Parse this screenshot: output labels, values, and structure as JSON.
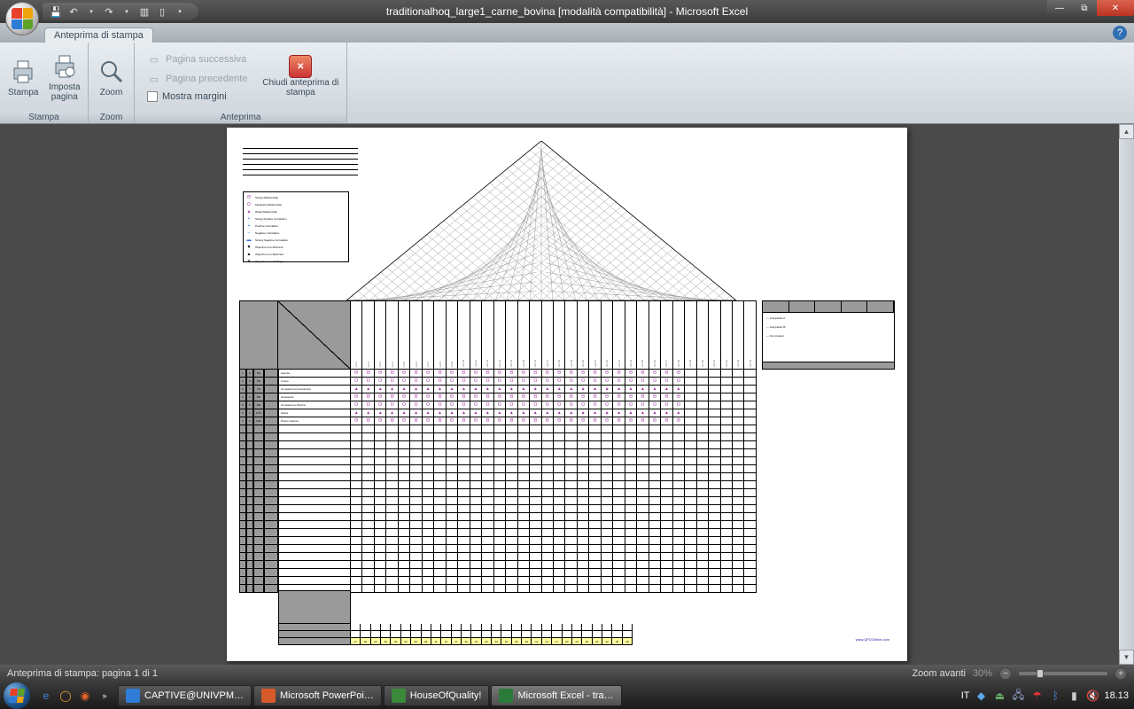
{
  "window": {
    "title": "traditionalhoq_large1_carne_bovina  [modalità compatibilità] - Microsoft Excel"
  },
  "tab": {
    "label": "Anteprima di stampa"
  },
  "ribbon": {
    "groups": {
      "stampa": {
        "title": "Stampa",
        "print": "Stampa",
        "page_setup": "Imposta pagina"
      },
      "zoom": {
        "title": "Zoom",
        "zoom": "Zoom"
      },
      "anteprima": {
        "title": "Anteprima",
        "next": "Pagina successiva",
        "prev": "Pagina precedente",
        "margins": "Mostra margini",
        "close": "Chiudi anteprima di stampa"
      }
    }
  },
  "status": {
    "left": "Anteprima di stampa: pagina 1 di 1",
    "zoom_label": "Zoom avanti",
    "zoom_pct": "30%"
  },
  "taskbar": {
    "items": [
      {
        "label": "CAPTIVE@UNIVPM…",
        "color": "#2e7cd6"
      },
      {
        "label": "Microsoft PowerPoi…",
        "color": "#d75b2a"
      },
      {
        "label": "HouseOfQuality!",
        "color": "#3a8a3a"
      },
      {
        "label": "Microsoft Excel - tra…",
        "color": "#2a7a3a"
      }
    ],
    "lang": "IT",
    "clock": "18.13"
  },
  "hoq": {
    "legend": [
      "Strong Relationship",
      "Moderate Relationship",
      "Weak Relationship",
      "Strong Positive Correlation",
      "Positive Correlation",
      "Negative Correlation",
      "Strong Negative Correlation",
      "Objective is to Minimize",
      "Objective is to Maximize",
      "Objective is to Hit Target"
    ],
    "columns_count": 34,
    "rows": [
      "Aspetto",
      "Colore",
      "Consistenza (meccanica)",
      "Grassezza",
      "Consistenza chimica",
      "Odore",
      "Potere calorico"
    ],
    "empty_rows": 21,
    "right_panel": [
      "Competitor A",
      "Competitor B",
      "Our product"
    ],
    "link": "www.QFDOnline.com"
  }
}
